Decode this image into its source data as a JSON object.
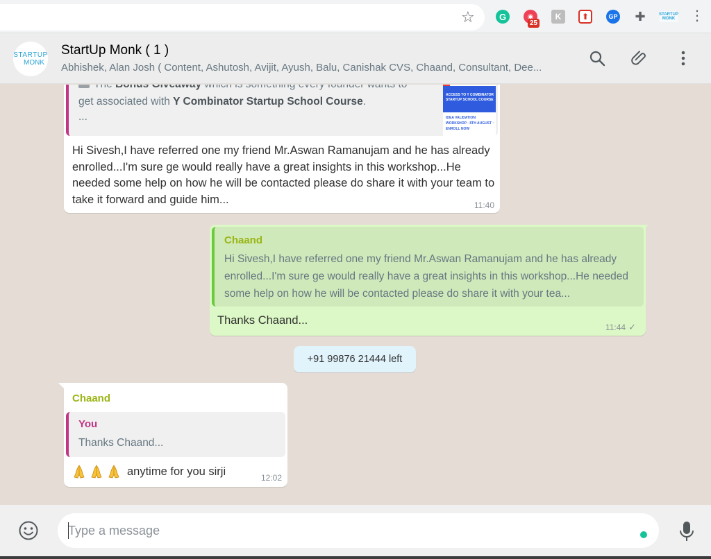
{
  "browser": {
    "extensions": [
      {
        "name": "grammarly",
        "label": "G"
      },
      {
        "name": "pocket",
        "badge": "25"
      },
      {
        "name": "k-extension",
        "label": "K"
      },
      {
        "name": "upload-extension",
        "label": "⬆"
      },
      {
        "name": "gp-extension",
        "label": "GP"
      },
      {
        "name": "startup-monk-extension",
        "label": "STARTUP MONK"
      }
    ]
  },
  "header": {
    "avatar_line1": "STARTUP",
    "avatar_line2": "MONK",
    "group_name": "StartUp Monk ( 1 )",
    "members": "Abhishek, Alan Josh ( Content, Ashutosh, Avijit, Ayush, Balu, Canishak CVS, Chaand, Consultant, Dee..."
  },
  "messages": [
    {
      "direction": "incoming",
      "quote": {
        "prefix": "The ",
        "bold1": "Bonus Giveaway",
        "mid": " which is something every founder wants to",
        "line2_prefix": "get associated with ",
        "bold2": "Y Combinator Startup School Course",
        "line2_suffix": ".",
        "line3": "...",
        "thumb_text": "ACCESS TO Y COMBINATOR STARTUP SCHOOL COURSE",
        "thumb_footer": "IDEA VALIDATION WORKSHOP · 8TH AUGUST · ENROLL NOW"
      },
      "text": "Hi Sivesh,I have referred one my friend Mr.Aswan Ramanujam and he has already enrolled...I'm sure ge would really have a great insights in this workshop...He needed some help on how he will be contacted please do share it with your team to take it forward and guide him...",
      "time": "11:40"
    },
    {
      "direction": "outgoing",
      "quote": {
        "author": "Chaand",
        "text": "Hi Sivesh,I have referred one my friend Mr.Aswan Ramanujam and he has already enrolled...I'm sure ge would really have a great insights in this workshop...He needed some help on how he will be contacted please do share it with your tea..."
      },
      "text": "Thanks Chaand...",
      "time": "11:44",
      "status": "✓"
    },
    {
      "direction": "system",
      "text": "+91 99876 21444 left"
    },
    {
      "direction": "incoming",
      "author": "Chaand",
      "quote": {
        "author": "You",
        "text": "Thanks Chaand..."
      },
      "text": "anytime for you sirji",
      "emoji_count": 3,
      "emoji_name": "folded-hands",
      "time": "12:02"
    }
  ],
  "composer": {
    "placeholder": "Type a message"
  },
  "colors": {
    "chat_bg": "#e5ddd5",
    "outgoing_bubble": "#dcf8c6",
    "system_bubble": "#e1f3fb",
    "author_color": "#9ab515",
    "you_color": "#c13584",
    "accent_green": "#15c39a"
  }
}
